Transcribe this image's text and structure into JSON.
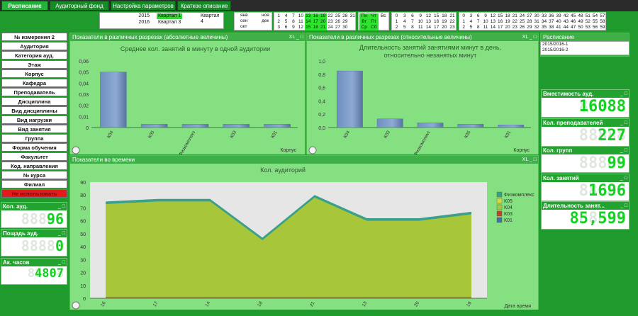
{
  "tabs": [
    {
      "label": "Расписание",
      "active": true
    },
    {
      "label": "Аудиторный фонд",
      "active": false
    },
    {
      "label": "Настройка параметров",
      "active": false
    },
    {
      "label": "Краткое описание",
      "active": false
    }
  ],
  "years": [
    {
      "year": "2015",
      "quarters": [
        "Квартал 1",
        "Квартал 4"
      ]
    },
    {
      "year": "2016",
      "quarters": [
        "Квартал 3"
      ]
    }
  ],
  "months": [
    [
      "янв",
      "ноя"
    ],
    [
      "сен",
      "дек"
    ],
    [
      "окт",
      ""
    ]
  ],
  "days_grid": {
    "rows": [
      [
        "1",
        "4",
        "7",
        "10",
        "13",
        "16",
        "19",
        "22",
        "25",
        "28",
        "31"
      ],
      [
        "2",
        "5",
        "8",
        "11",
        "14",
        "17",
        "20",
        "23",
        "26",
        "29",
        ""
      ],
      [
        "3",
        "6",
        "9",
        "12",
        "15",
        "18",
        "21",
        "24",
        "27",
        "30",
        ""
      ]
    ],
    "highlighted_cols": [
      4,
      5,
      6
    ]
  },
  "weekdays": [
    [
      "Пн",
      "Чт",
      "Вс"
    ],
    [
      "Вт",
      "Пт",
      ""
    ],
    [
      "Ср",
      "Сб",
      ""
    ]
  ],
  "hours_grid": [
    [
      "0",
      "3",
      "6",
      "9",
      "12",
      "15",
      "18",
      "21"
    ],
    [
      "1",
      "4",
      "7",
      "10",
      "13",
      "16",
      "19",
      "22"
    ],
    [
      "2",
      "5",
      "8",
      "11",
      "14",
      "17",
      "20",
      "23"
    ]
  ],
  "minutes_grid": [
    [
      "0",
      "3",
      "6",
      "9",
      "12",
      "15",
      "18",
      "21",
      "24",
      "27",
      "30",
      "33",
      "36",
      "39",
      "42",
      "45",
      "48",
      "51",
      "54",
      "57"
    ],
    [
      "1",
      "4",
      "7",
      "10",
      "13",
      "16",
      "19",
      "22",
      "25",
      "28",
      "31",
      "34",
      "37",
      "40",
      "43",
      "46",
      "49",
      "52",
      "55",
      "58"
    ],
    [
      "2",
      "5",
      "8",
      "11",
      "14",
      "17",
      "20",
      "23",
      "26",
      "29",
      "32",
      "35",
      "38",
      "41",
      "44",
      "47",
      "50",
      "53",
      "56",
      "59"
    ]
  ],
  "sidebar": {
    "items": [
      "№ измерения 2",
      "Аудитория",
      "Категория ауд.",
      "Этаж",
      "Корпус",
      "Кафедра",
      "Преподаватель",
      "Дисциплина",
      "Вид дисциплины",
      "Вид нагрузки",
      "Вид занятия",
      "Группа",
      "Форма обучения",
      "Факультет",
      "Код. направления",
      "№ курса",
      "Филиал",
      "Не использовать"
    ]
  },
  "left_kpis": [
    {
      "title": "Кол. ауд.",
      "value": "96"
    },
    {
      "title": "Пощадь ауд.",
      "value": "0"
    },
    {
      "title": "Ак. часов",
      "value": "4807"
    }
  ],
  "right_kpis": [
    {
      "title": "Вместимость ауд.",
      "value": "16088"
    },
    {
      "title": "Кол. преподавателей",
      "value": "227"
    },
    {
      "title": "Кол. групп",
      "value": "99"
    },
    {
      "title": "Кол. занятий",
      "value": "1696"
    },
    {
      "title": "Длительность занят...",
      "value": "85,599"
    }
  ],
  "schedule_list": {
    "title": "Расписание",
    "items": [
      "2015/2016-1",
      "2015/2016-2"
    ]
  },
  "panel_titles": {
    "abs": "Показатели в различных разрезах (абсолютные величины)",
    "rel": "Показатели в различных разрезах (относительные величины)",
    "time": "Показатели во времени"
  },
  "panel_buttons": "XL _ □",
  "chart_data": [
    {
      "type": "bar",
      "title": "Среднее кол. занятий в минуту в одной аудитории",
      "xlabel": "Корпус",
      "categories": [
        "К04",
        "К05",
        "Физкомплекс",
        "К03",
        "К01"
      ],
      "values": [
        0.05,
        0.003,
        0.003,
        0.003,
        0.003
      ],
      "ylim": [
        0,
        0.06
      ],
      "yticks": [
        "0",
        "0,01",
        "0,02",
        "0,03",
        "0,04",
        "0,05",
        "0,06"
      ]
    },
    {
      "type": "bar",
      "title": "Длительность занятий занятиями минут в день, относительно незанятых минут",
      "title_lines": [
        "Длительность занятий занятиями минут в день,",
        "относительно незанятых минут"
      ],
      "xlabel": "Корпус",
      "categories": [
        "К04",
        "К03",
        "Физкомплекс",
        "К05",
        "К01"
      ],
      "values": [
        0.85,
        0.13,
        0.07,
        0.05,
        0.04
      ],
      "ylim": [
        0,
        1.0
      ],
      "yticks": [
        "0,0",
        "0,2",
        "0,4",
        "0,6",
        "0,8",
        "1,0"
      ]
    },
    {
      "type": "area",
      "title": "Кол. аудиторий",
      "xlabel": "Дата время",
      "x": [
        "16",
        "17",
        "14",
        "18",
        "21",
        "13",
        "20",
        "19"
      ],
      "ylim": [
        0,
        90
      ],
      "yticks": [
        "0",
        "10",
        "20",
        "30",
        "40",
        "50",
        "60",
        "70",
        "80",
        "90"
      ],
      "series": [
        {
          "name": "Физкомплекс",
          "values": [
            1,
            1,
            1,
            1,
            1,
            1,
            1,
            1
          ],
          "color": "#3aa08c"
        },
        {
          "name": "К05",
          "values": [
            0,
            0,
            0,
            0,
            0,
            0,
            0,
            0
          ],
          "color": "#d8d83a"
        },
        {
          "name": "К04",
          "values": [
            73,
            75,
            75,
            45,
            78,
            60,
            60,
            65
          ],
          "color": "#a8c63a"
        },
        {
          "name": "К03",
          "values": [
            1,
            1,
            1,
            1,
            1,
            1,
            1,
            1
          ],
          "color": "#c8402a"
        },
        {
          "name": "К01",
          "values": [
            0,
            0,
            0,
            0,
            0,
            0,
            0,
            0
          ],
          "color": "#4a6ab0"
        }
      ]
    }
  ]
}
